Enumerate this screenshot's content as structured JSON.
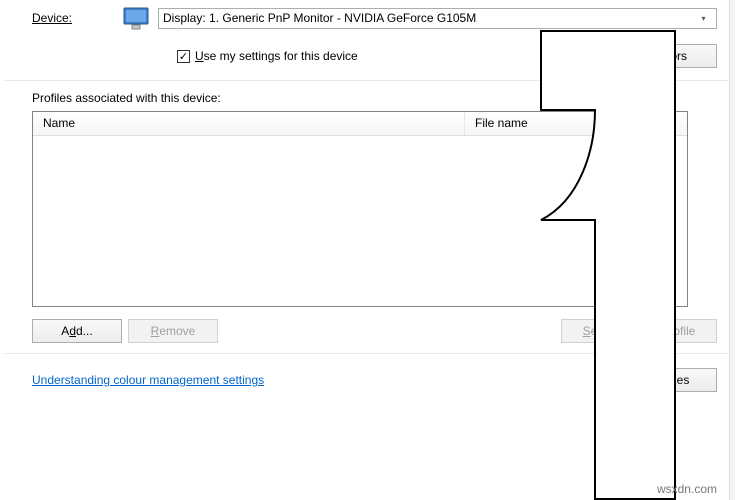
{
  "device": {
    "label": "Device:",
    "selected": "Display: 1. Generic PnP Monitor - NVIDIA GeForce G105M"
  },
  "use_settings": {
    "checked": true,
    "label": "Use my settings for this device"
  },
  "identify_button": "Identify monitors",
  "profiles": {
    "label": "Profiles associated with this device:",
    "columns": {
      "name": "Name",
      "file": "File name"
    },
    "rows": []
  },
  "buttons": {
    "add": "Add...",
    "remove": "Remove",
    "set_default": "Set as Default Profile",
    "properties": "Properties"
  },
  "link_text": "Understanding colour management settings",
  "watermark": "wsxdn.com"
}
